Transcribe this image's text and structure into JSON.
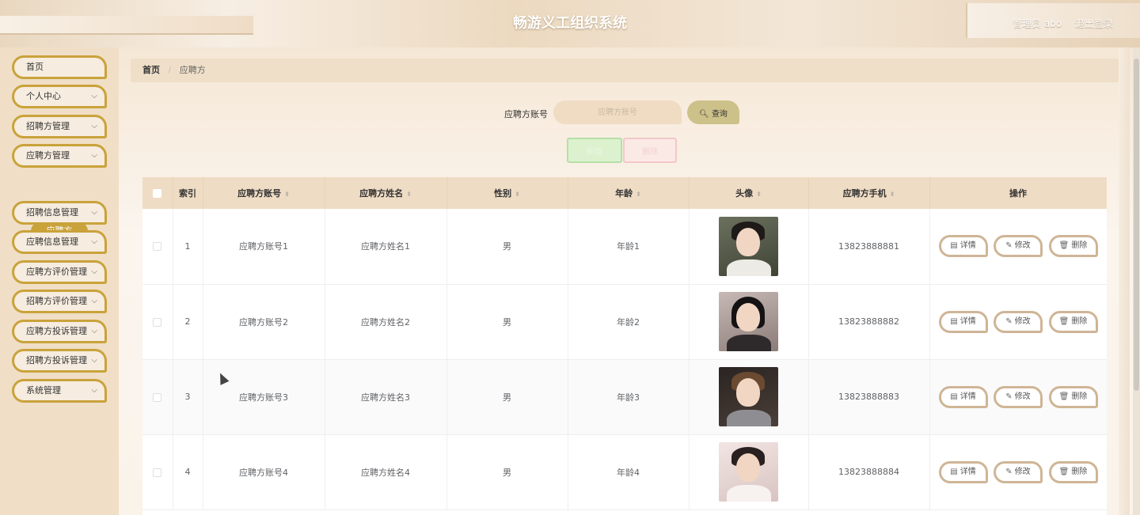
{
  "header": {
    "title": "畅游义工组织系统",
    "role": "管理员 abo",
    "logout": "退出登录"
  },
  "sidebar": {
    "items": [
      {
        "label": "首页",
        "has_children": false
      },
      {
        "label": "个人中心",
        "has_children": true
      },
      {
        "label": "招聘方管理",
        "has_children": true
      },
      {
        "label": "应聘方管理",
        "has_children": true
      },
      {
        "label": "招聘信息管理",
        "has_children": true
      },
      {
        "label": "应聘信息管理",
        "has_children": true
      },
      {
        "label": "应聘方评价管理",
        "has_children": true
      },
      {
        "label": "招聘方评价管理",
        "has_children": true
      },
      {
        "label": "应聘方投诉管理",
        "has_children": true
      },
      {
        "label": "招聘方投诉管理",
        "has_children": true
      },
      {
        "label": "系统管理",
        "has_children": true
      }
    ],
    "active_sub": "应聘方"
  },
  "breadcrumb": {
    "home": "首页",
    "separator": "/",
    "current": "应聘方"
  },
  "search": {
    "label": "应聘方账号",
    "placeholder": "应聘方账号",
    "button": "查询",
    "button_icon": "search-icon"
  },
  "actions": {
    "add": "新增",
    "delete": "删除"
  },
  "table": {
    "columns": [
      "",
      "索引",
      "应聘方账号",
      "应聘方姓名",
      "性别",
      "年龄",
      "头像",
      "应聘方手机",
      "操作"
    ],
    "sortable": [
      false,
      false,
      true,
      true,
      true,
      true,
      true,
      true,
      false
    ],
    "rows": [
      {
        "index": "1",
        "account": "应聘方账号1",
        "name": "应聘方姓名1",
        "gender": "男",
        "age": "年龄1",
        "phone": "13823888881",
        "avatar": "avatar-photo-1"
      },
      {
        "index": "2",
        "account": "应聘方账号2",
        "name": "应聘方姓名2",
        "gender": "男",
        "age": "年龄2",
        "phone": "13823888882",
        "avatar": "avatar-photo-2"
      },
      {
        "index": "3",
        "account": "应聘方账号3",
        "name": "应聘方姓名3",
        "gender": "男",
        "age": "年龄3",
        "phone": "13823888883",
        "avatar": "avatar-photo-3"
      },
      {
        "index": "4",
        "account": "应聘方账号4",
        "name": "应聘方姓名4",
        "gender": "男",
        "age": "年龄4",
        "phone": "13823888884",
        "avatar": "avatar-photo-4"
      }
    ],
    "row_actions": {
      "detail": "详情",
      "edit": "修改",
      "delete": "删除"
    }
  },
  "colors": {
    "accent": "#c9a23a",
    "header_bg": "#efdcc4",
    "search_button": "#cdc18a"
  }
}
